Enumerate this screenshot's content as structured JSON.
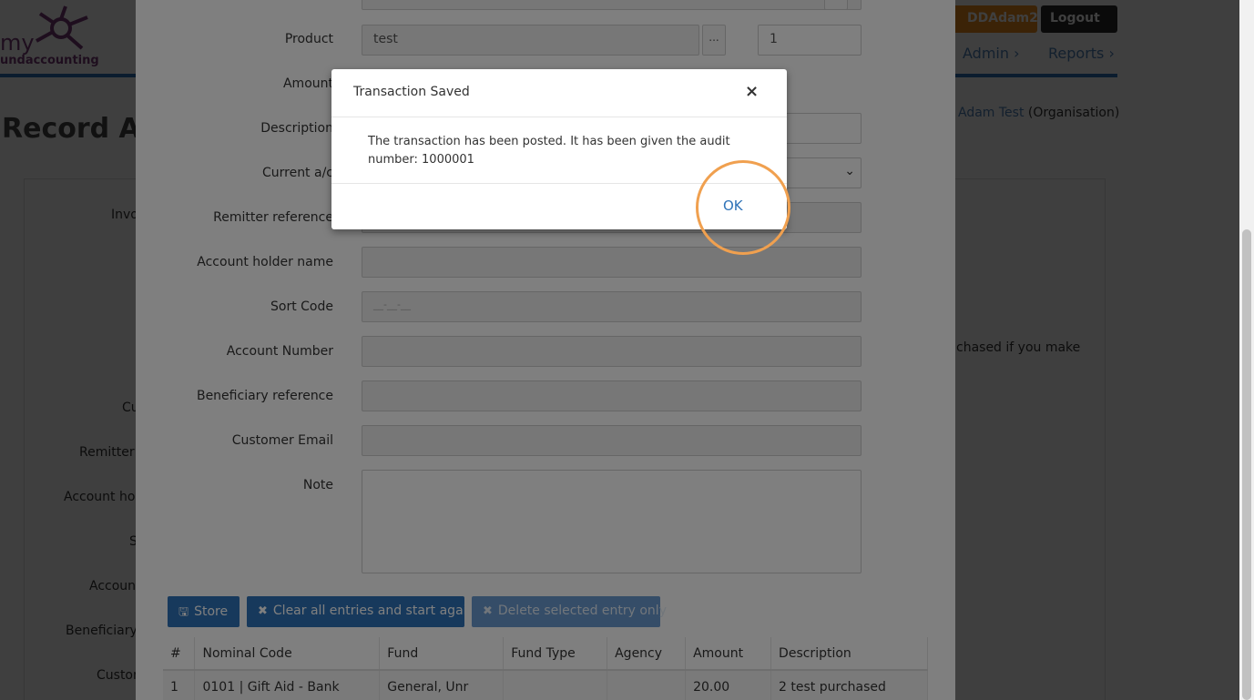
{
  "background": {
    "logo": {
      "text_top": "my",
      "text_bottom": "undaccounting"
    },
    "header": {
      "user_button": "DDAdam2",
      "logout_button": "Logout"
    },
    "nav": {
      "admin": "Admin ›",
      "reports": "Reports ›"
    },
    "org": {
      "user_link": "Adam Test",
      "org_label": "(Organisation)"
    },
    "page_title": "Record A Sa",
    "left_labels": [
      "Invo",
      "Cu",
      "Remitter r",
      "Account hold",
      "S",
      "Account",
      "Beneficiary r",
      "Custom"
    ],
    "hint_text": "chased if you make"
  },
  "form_modal": {
    "fields": {
      "product_label": "Product",
      "product_value": "test",
      "product_lookup": "...",
      "quantity_value": "1",
      "amount_label": "Amount",
      "description_label": "Description",
      "current_ac_label": "Current a/c",
      "remitter_label": "Remitter reference",
      "holder_label": "Account holder name",
      "sort_code_label": "Sort Code",
      "sort_code_placeholder": "__-__-__",
      "account_number_label": "Account Number",
      "beneficiary_label": "Beneficiary reference",
      "email_label": "Customer Email",
      "note_label": "Note"
    },
    "buttons": {
      "store": "Store",
      "clear": "Clear all entries and start again",
      "delete": "Delete selected entry only"
    },
    "table": {
      "columns": [
        "#",
        "Nominal Code",
        "Fund",
        "Fund Type",
        "Agency",
        "Amount",
        "Description"
      ],
      "rows": [
        [
          "1",
          "0101 | Gift Aid - Bank",
          "General, Unr",
          "",
          "",
          "20.00",
          "2 test purchased"
        ]
      ]
    }
  },
  "dialog": {
    "title": "Transaction Saved",
    "close": "×",
    "message": "The transaction has been posted. It has been given the audit number: 1000001",
    "ok_label": "OK"
  },
  "colors": {
    "accent_blue": "#2f73b8",
    "highlight_orange": "#f0a04f",
    "user_button_orange": "#ee8f1c"
  }
}
